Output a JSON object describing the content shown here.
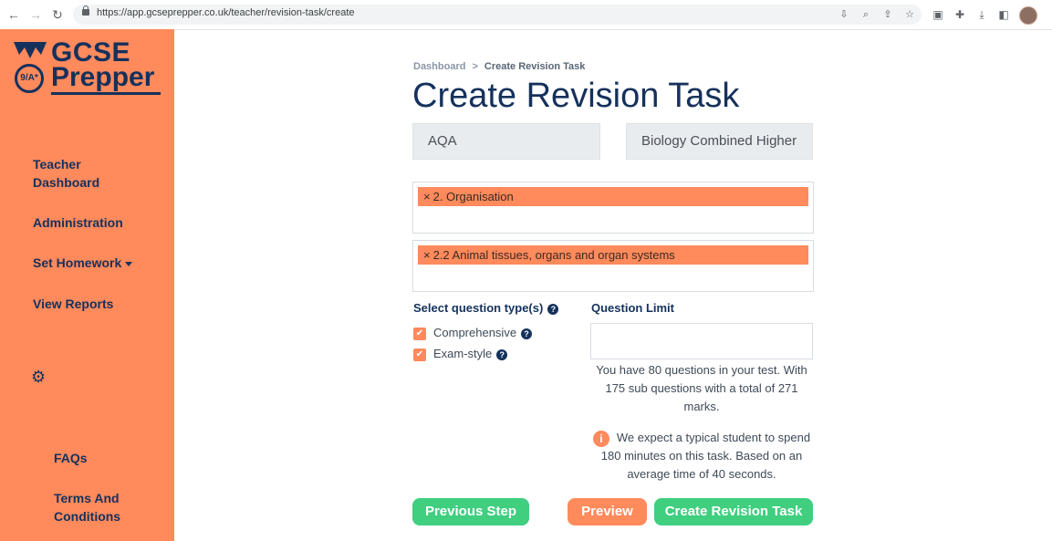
{
  "browser": {
    "url": "https://app.gcseprepper.co.uk/teacher/revision-task/create"
  },
  "logo": {
    "line1": "GCSE",
    "line2": "Prepper",
    "badge": "9/A*"
  },
  "sidebar": {
    "items": [
      {
        "label": "Teacher Dashboard"
      },
      {
        "label": "Administration"
      },
      {
        "label": "Set Homework"
      },
      {
        "label": "View Reports"
      }
    ],
    "bottom_items": [
      {
        "label": "FAQs"
      },
      {
        "label": "Terms And Conditions"
      }
    ]
  },
  "breadcrumb": {
    "home": "Dashboard",
    "separator": ">",
    "current": "Create Revision Task"
  },
  "page": {
    "title": "Create Revision Task"
  },
  "selects": {
    "exam_board": "AQA",
    "course": "Biology Combined Higher"
  },
  "topics": {
    "selected": "2. Organisation"
  },
  "subtopics": {
    "selected": "2.2 Animal tissues, organs and organ systems"
  },
  "question_types": {
    "label": "Select question type(s)",
    "options": [
      {
        "label": "Comprehensive",
        "checked": true
      },
      {
        "label": "Exam-style",
        "checked": true
      }
    ]
  },
  "question_limit": {
    "label": "Question Limit",
    "value": ""
  },
  "summary": {
    "questions_text": "You have 80 questions in your test. With 175 sub questions with a total of 271 marks.",
    "time_text": "We expect a typical student to spend 180 minutes on this task. Based on an average time of 40 seconds."
  },
  "buttons": {
    "previous": "Previous Step",
    "preview": "Preview",
    "create": "Create Revision Task"
  },
  "colors": {
    "sidebar": "#ff8a5c",
    "navy": "#15315c",
    "green": "#3fcf7f"
  }
}
